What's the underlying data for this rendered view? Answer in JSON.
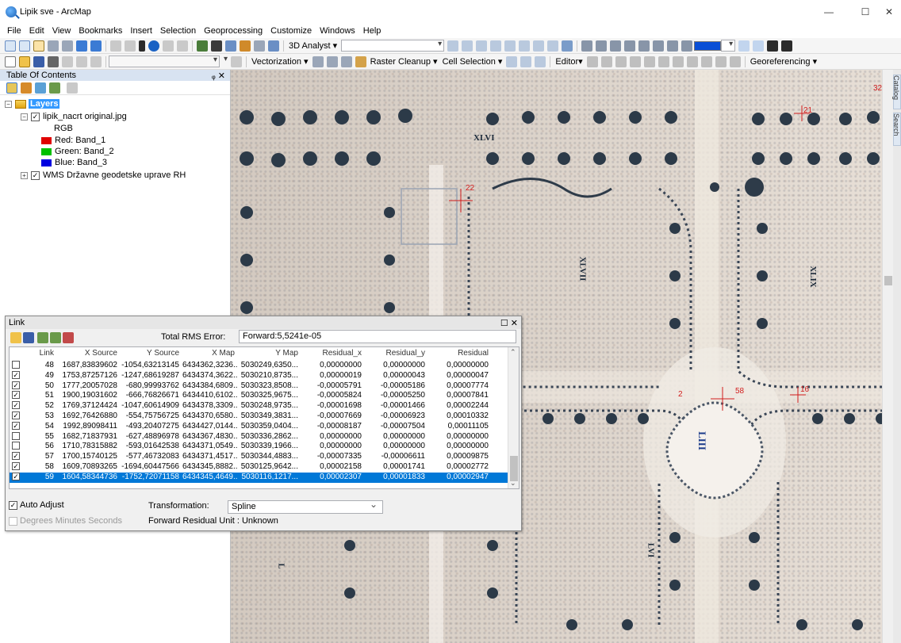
{
  "window": {
    "title": "Lipik sve - ArcMap",
    "minimize": "—",
    "maximize": "☐",
    "close": "✕"
  },
  "menu": [
    "File",
    "Edit",
    "View",
    "Bookmarks",
    "Insert",
    "Selection",
    "Geoprocessing",
    "Customize",
    "Windows",
    "Help"
  ],
  "toolbar1": {
    "analyst_label": "3D Analyst ▾"
  },
  "toolbar2": {
    "vectorization_label": "Vectorization ▾",
    "raster_cleanup_label": "Raster Cleanup ▾",
    "cell_selection_label": "Cell Selection ▾",
    "editor_label": "Editor▾",
    "georeferencing_label": "Georeferencing ▾"
  },
  "toc": {
    "title": "Table Of Contents",
    "pin": "ᵩ ✕",
    "layers_label": "Layers",
    "raster_layer": "lipik_nacrt original.jpg",
    "rgb_label": "RGB",
    "bands": [
      {
        "label": "Red:   Band_1",
        "color": "#e00000"
      },
      {
        "label": "Green: Band_2",
        "color": "#00c000"
      },
      {
        "label": "Blue:   Band_3",
        "color": "#0000e0"
      }
    ],
    "wms_layer": "WMS Državne geodetske uprave RH"
  },
  "map": {
    "labels": {
      "xlvi": "XLVI",
      "xlvii": "XLVII",
      "xlix": "XLIX",
      "l": "L",
      "liii": "LIII",
      "lvi": "LVI"
    },
    "link_numbers": {
      "n22": "22",
      "n58": "58",
      "n16": "16",
      "n32": "32",
      "n21": "21",
      "n2": "2"
    }
  },
  "side_tabs": {
    "catalog": "Catalog",
    "search": "Search"
  },
  "link_window": {
    "title": "Link",
    "title_controls": "☐ ✕",
    "rms_label": "Total RMS Error:",
    "rms_value": "Forward:5,5241e-05",
    "columns": [
      "Link",
      "X Source",
      "Y Source",
      "X Map",
      "Y Map",
      "Residual_x",
      "Residual_y",
      "Residual"
    ],
    "rows": [
      {
        "checked": "",
        "link": "48",
        "xs": "1687,83839602",
        "ys": "-1054,63213145",
        "xm": "6434362,3236...",
        "ym": "5030249,6350...",
        "rx": "0,00000000",
        "ry": "0,00000000",
        "r": "0,00000000"
      },
      {
        "checked": "✓",
        "link": "49",
        "xs": "1753,87257126",
        "ys": "-1247,68619287",
        "xm": "6434374,3622...",
        "ym": "5030210,8735...",
        "rx": "0,00000019",
        "ry": "0,00000043",
        "r": "0,00000047"
      },
      {
        "checked": "✓",
        "link": "50",
        "xs": "1777,20057028",
        "ys": "-680,99993762",
        "xm": "6434384,6809...",
        "ym": "5030323,8508...",
        "rx": "-0,00005791",
        "ry": "-0,00005186",
        "r": "0,00007774"
      },
      {
        "checked": "✓",
        "link": "51",
        "xs": "1900,19031602",
        "ys": "-666,76826671",
        "xm": "6434410,6102...",
        "ym": "5030325,9675...",
        "rx": "-0,00005824",
        "ry": "-0,00005250",
        "r": "0,00007841"
      },
      {
        "checked": "✓",
        "link": "52",
        "xs": "1769,37124424",
        "ys": "-1047,60614909",
        "xm": "6434378,3309...",
        "ym": "5030248,9735...",
        "rx": "-0,00001698",
        "ry": "-0,00001466",
        "r": "0,00002244"
      },
      {
        "checked": "✓",
        "link": "53",
        "xs": "1692,76426880",
        "ys": "-554,75756725",
        "xm": "6434370,6580...",
        "ym": "5030349,3831...",
        "rx": "-0,00007669",
        "ry": "-0,00006923",
        "r": "0,00010332"
      },
      {
        "checked": "✓",
        "link": "54",
        "xs": "1992,89098411",
        "ys": "-493,20407275",
        "xm": "6434427,0144...",
        "ym": "5030359,0404...",
        "rx": "-0,00008187",
        "ry": "-0,00007504",
        "r": "0,00011105"
      },
      {
        "checked": "",
        "link": "55",
        "xs": "1682,71837931",
        "ys": "-627,48896978",
        "xm": "6434367,4830...",
        "ym": "5030336,2862...",
        "rx": "0,00000000",
        "ry": "0,00000000",
        "r": "0,00000000"
      },
      {
        "checked": "",
        "link": "56",
        "xs": "1710,78315882",
        "ys": "-593,01642538",
        "xm": "6434371,0549...",
        "ym": "5030339,1966...",
        "rx": "0,00000000",
        "ry": "0,00000000",
        "r": "0,00000000"
      },
      {
        "checked": "✓",
        "link": "57",
        "xs": "1700,15740125",
        "ys": "-577,46732083",
        "xm": "6434371,4517...",
        "ym": "5030344,4883...",
        "rx": "-0,00007335",
        "ry": "-0,00006611",
        "r": "0,00009875"
      },
      {
        "checked": "✓",
        "link": "58",
        "xs": "1609,70893265",
        "ys": "-1694,60447566",
        "xm": "6434345,8882...",
        "ym": "5030125,9642...",
        "rx": "0,00002158",
        "ry": "0,00001741",
        "r": "0,00002772"
      },
      {
        "checked": "✓",
        "link": "59",
        "xs": "1604,58344736",
        "ys": "-1752,72071158",
        "xm": "6434345,4649...",
        "ym": "5030116,1217...",
        "rx": "0,00002307",
        "ry": "0,00001833",
        "r": "0,00002947",
        "selected": true
      }
    ],
    "auto_adjust_label": "Auto Adjust",
    "auto_adjust_checked": "✓",
    "dms_label": "Degrees Minutes Seconds",
    "transformation_label": "Transformation:",
    "transformation_value": "Spline",
    "forward_residual_unit": "Forward Residual Unit : Unknown"
  }
}
